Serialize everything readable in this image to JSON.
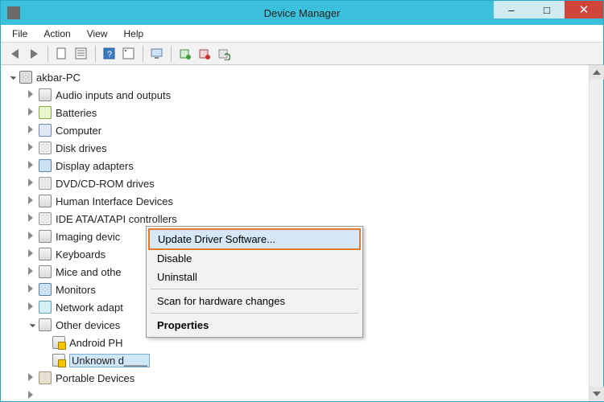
{
  "window": {
    "title": "Device Manager",
    "controls": {
      "min": "–",
      "max": "□",
      "close": "✕"
    }
  },
  "menubar": [
    "File",
    "Action",
    "View",
    "Help"
  ],
  "tree": {
    "root": {
      "label": "akbar-PC",
      "expanded": true
    },
    "categories": [
      {
        "label": "Audio inputs and outputs",
        "icon": "ic-generic"
      },
      {
        "label": "Batteries",
        "icon": "ic-battery"
      },
      {
        "label": "Computer",
        "icon": "ic-computer"
      },
      {
        "label": "Disk drives",
        "icon": "ic-drive"
      },
      {
        "label": "Display adapters",
        "icon": "ic-monitor"
      },
      {
        "label": "DVD/CD-ROM drives",
        "icon": "ic-drive"
      },
      {
        "label": "Human Interface Devices",
        "icon": "ic-generic"
      },
      {
        "label": "IDE ATA/ATAPI controllers",
        "icon": "ic-drive"
      },
      {
        "label": "Imaging devic",
        "icon": "ic-generic"
      },
      {
        "label": "Keyboards",
        "icon": "ic-generic"
      },
      {
        "label": "Mice and othe",
        "icon": "ic-generic"
      },
      {
        "label": "Monitors",
        "icon": "ic-monitor"
      },
      {
        "label": "Network adapt",
        "icon": "ic-network"
      }
    ],
    "other_devices": {
      "label": "Other devices",
      "children": [
        {
          "label": "Android PH",
          "warn": true
        },
        {
          "label": "Unknown d____",
          "warn": true,
          "selected": true
        }
      ]
    },
    "after": [
      {
        "label": "Portable Devices",
        "icon": "ic-portable"
      }
    ]
  },
  "context_menu": {
    "items": [
      {
        "label": "Update Driver Software...",
        "highlight": true
      },
      {
        "label": "Disable"
      },
      {
        "label": "Uninstall"
      },
      {
        "sep": true
      },
      {
        "label": "Scan for hardware changes"
      },
      {
        "sep": true
      },
      {
        "label": "Properties",
        "bold": true
      }
    ]
  }
}
